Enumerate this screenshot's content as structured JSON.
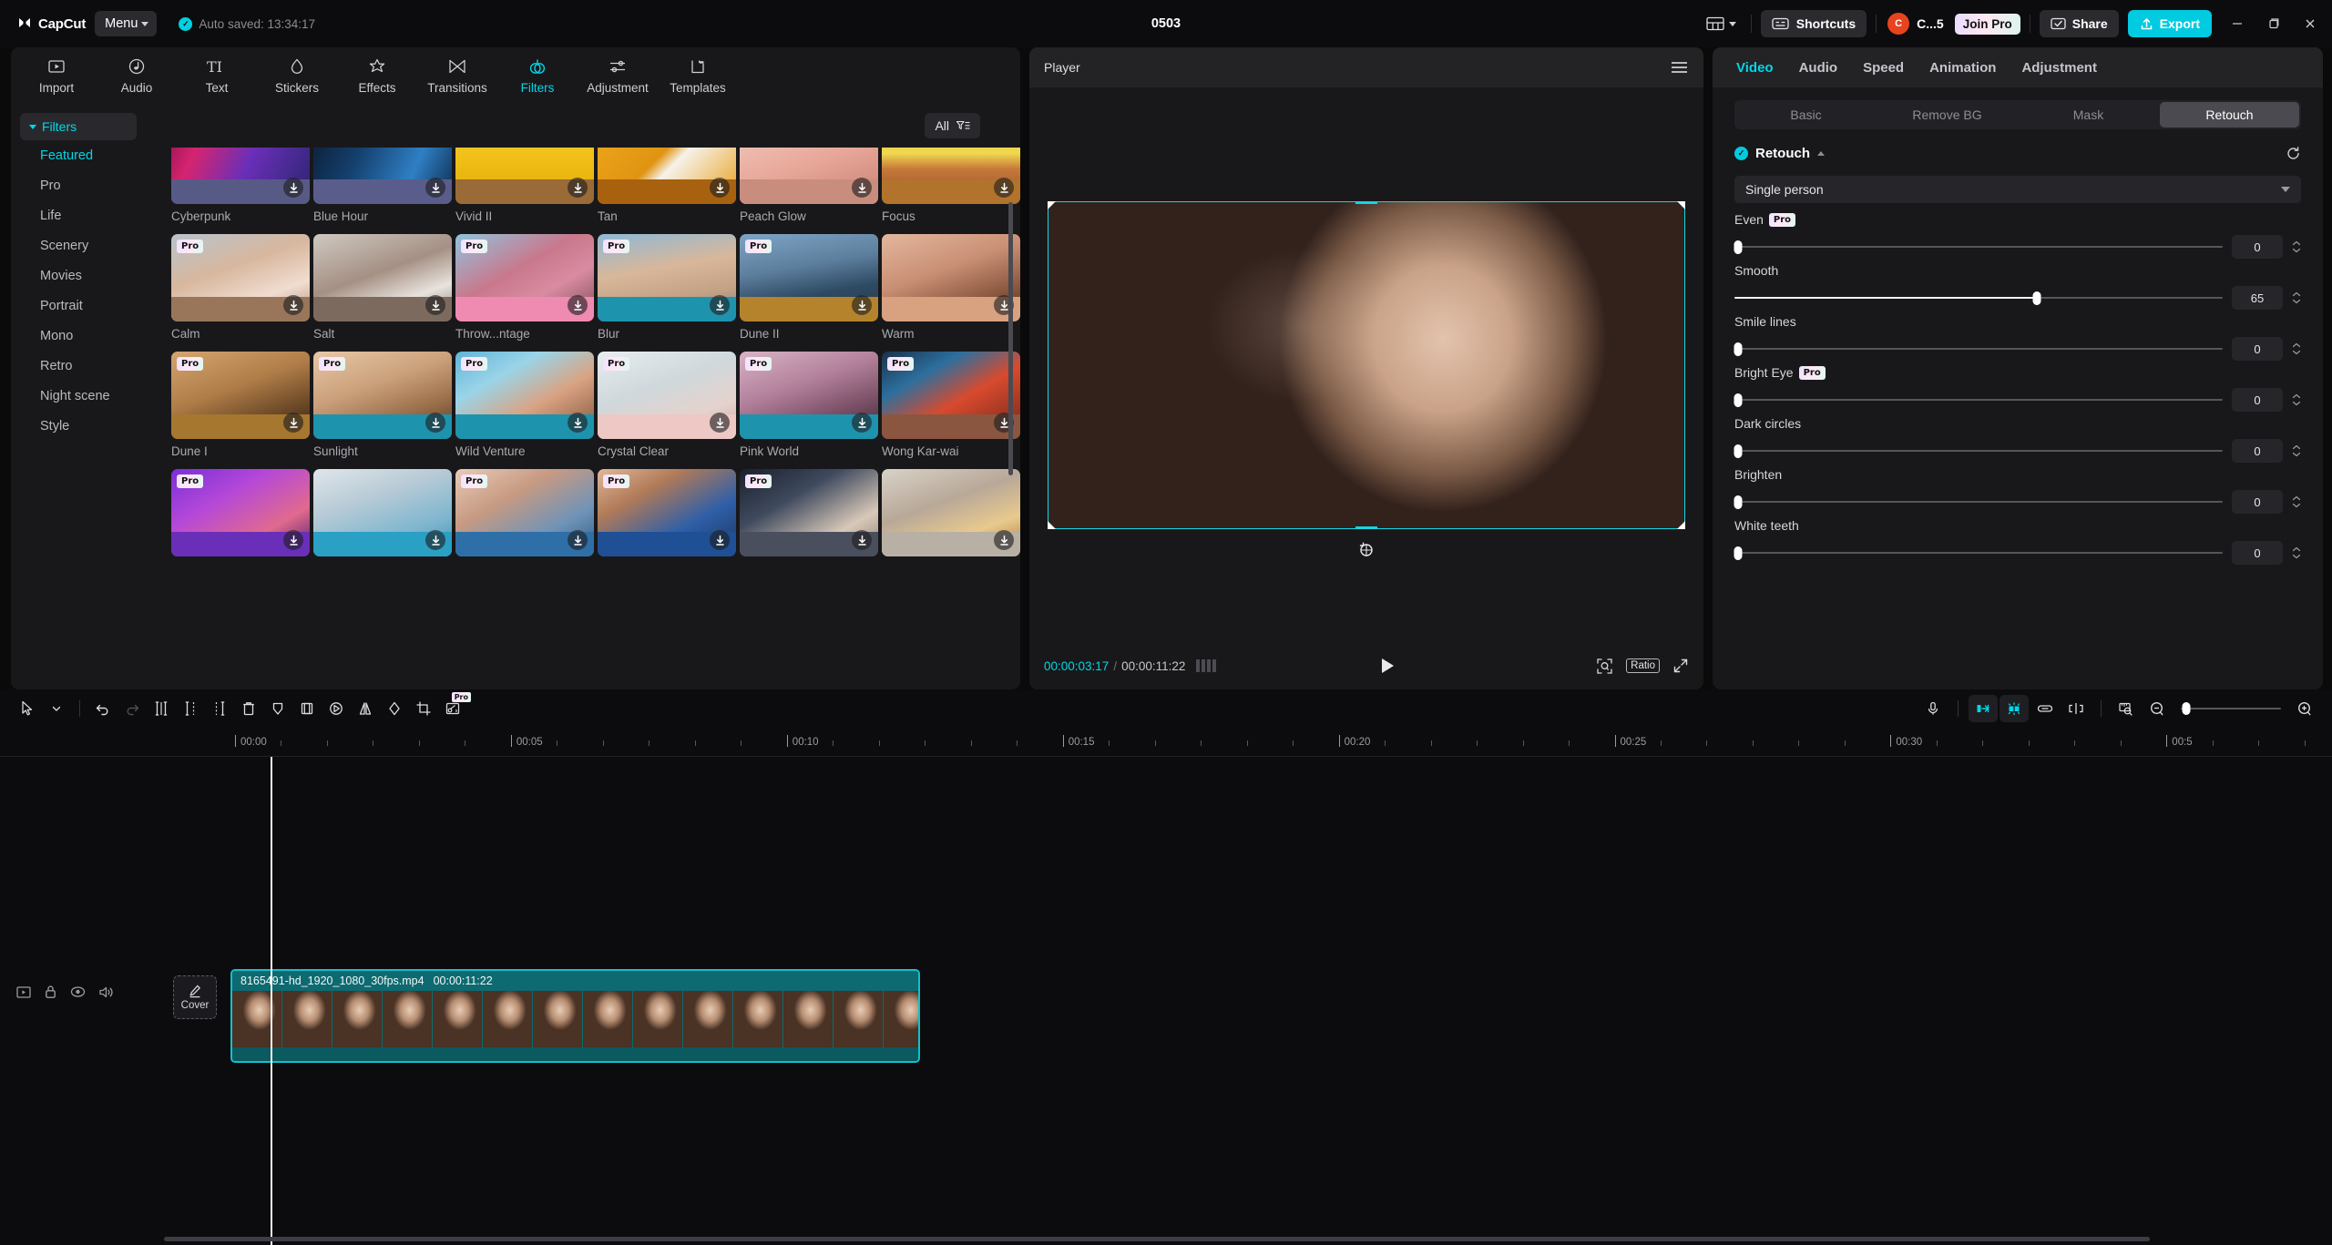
{
  "titlebar": {
    "brand": "CapCut",
    "menu_label": "Menu",
    "autosave_text": "Auto saved: 13:34:17",
    "project_title": "0503",
    "shortcuts_label": "Shortcuts",
    "account_initial": "C",
    "account_name": "C...5",
    "join_pro_label": "Join Pro",
    "share_label": "Share",
    "export_label": "Export",
    "accent_color": "#00cbe0",
    "icons": {
      "layout": "layout-grid-icon",
      "layout_caret": "chevron-down-icon",
      "shortcuts": "keyboard-icon",
      "share": "share-icon",
      "export": "upload-icon",
      "minimize": "minimize-icon",
      "maximize": "maximize-icon",
      "close": "close-icon"
    }
  },
  "toolbar": {
    "tabs": [
      {
        "label": "Import",
        "icon": "media-import-icon",
        "active": false
      },
      {
        "label": "Audio",
        "icon": "audio-note-icon",
        "active": false
      },
      {
        "label": "Text",
        "icon": "text-ti-icon",
        "active": false
      },
      {
        "label": "Stickers",
        "icon": "sticker-drop-icon",
        "active": false
      },
      {
        "label": "Effects",
        "icon": "effects-star-icon",
        "active": false
      },
      {
        "label": "Transitions",
        "icon": "transitions-bowtie-icon",
        "active": false
      },
      {
        "label": "Filters",
        "icon": "filters-rings-icon",
        "active": true
      },
      {
        "label": "Adjustment",
        "icon": "adjustment-sliders-icon",
        "active": false
      },
      {
        "label": "Templates",
        "icon": "templates-flag-icon",
        "active": false
      }
    ]
  },
  "categories": {
    "header": "Filters",
    "items": [
      {
        "label": "Featured",
        "active": true
      },
      {
        "label": "Pro",
        "active": false
      },
      {
        "label": "Life",
        "active": false
      },
      {
        "label": "Scenery",
        "active": false
      },
      {
        "label": "Movies",
        "active": false
      },
      {
        "label": "Portrait",
        "active": false
      },
      {
        "label": "Mono",
        "active": false
      },
      {
        "label": "Retro",
        "active": false
      },
      {
        "label": "Night scene",
        "active": false
      },
      {
        "label": "Style",
        "active": false
      }
    ]
  },
  "filter_grid": {
    "filter_button_label": "All",
    "filter_button_icon": "filter-sort-icon",
    "items": [
      {
        "name": "Cyberpunk",
        "pro": false,
        "top": "linear-gradient(115deg,#8d1050 0%,#d6246f 22%,#6a2fb8 55%,#2b2570 100%)",
        "bottom": "#585a86"
      },
      {
        "name": "Blue Hour",
        "pro": false,
        "top": "linear-gradient(115deg,#0b1b30 0%,#14406e 35%,#2f7fc4 70%,#0d2a4a 100%)",
        "bottom": "#5a5d8b"
      },
      {
        "name": "Vivid II",
        "pro": false,
        "top": "linear-gradient(180deg,#3f9fe0 0%,#63b7ea 34%,#f4c41c 36%,#e9b510 72%,#8e5b2a 74%)",
        "bottom": "#9a6b37"
      },
      {
        "name": "Tan",
        "pro": false,
        "top": "linear-gradient(135deg,#f0a91d 0%,#e09412 45%,#f6f2ea 55%,#e89c14 100%)",
        "bottom": "#a8620f"
      },
      {
        "name": "Peach Glow",
        "pro": false,
        "top": "linear-gradient(160deg,#f3cdc2 0%,#e8a99b 50%,#c98172 100%)",
        "bottom": "#c98d7e"
      },
      {
        "name": "Focus",
        "pro": false,
        "top": "linear-gradient(180deg,#e8c72c 0%,#f0d84f 42%,#c7793a 60%,#8a4d24 100%)",
        "bottom": "#b2732c"
      },
      {
        "name": "Calm",
        "pro": true,
        "top": "linear-gradient(160deg,#b9c3cb 0%,#d8b79e 40%,#f0ddd0 70%,#b08d74 100%)",
        "bottom": "#99765a"
      },
      {
        "name": "Salt",
        "pro": false,
        "top": "linear-gradient(160deg,#cfc9c1 0%,#a59084 45%,#e8e3dd 72%,#8a7a6c 100%)",
        "bottom": "#7d6a5e"
      },
      {
        "name": "Throw...ntage",
        "pro": true,
        "top": "linear-gradient(150deg,#8fc4de 0%,#c9788c 42%,#d98ba1 66%,#7a4a58 100%)",
        "bottom": "#ef8ab0"
      },
      {
        "name": "Blur",
        "pro": true,
        "top": "linear-gradient(170deg,#8fb9d6 0%,#d8b79a 40%,#c4a184 70%,#5e7f99 100%)",
        "bottom": "#1e93ad"
      },
      {
        "name": "Dune II",
        "pro": true,
        "top": "linear-gradient(170deg,#7fa4c4 0%,#5d7f9e 38%,#2e4a63 66%,#24384b 100%)",
        "bottom": "#b5832b"
      },
      {
        "name": "Warm",
        "pro": false,
        "top": "linear-gradient(160deg,#e3b79e 0%,#c98f74 42%,#8d5a42 72%,#4a2c1e 100%)",
        "bottom": "#d8a17f"
      },
      {
        "name": "Dune I",
        "pro": true,
        "top": "linear-gradient(160deg,#d4a570 0%,#b07d48 42%,#6d4a28 72%,#2e2014 100%)",
        "bottom": "#a6772f"
      },
      {
        "name": "Sunlight",
        "pro": true,
        "top": "linear-gradient(160deg,#e8c8a8 0%,#caa07a 40%,#9a6e4a 70%,#503524 100%)",
        "bottom": "#1e93ad"
      },
      {
        "name": "Wild Venture",
        "pro": true,
        "top": "linear-gradient(150deg,#5fb4d8 0%,#9ad4e8 30%,#d9a383 60%,#7c5236 100%)",
        "bottom": "#1e93ad"
      },
      {
        "name": "Crystal Clear",
        "pro": true,
        "top": "linear-gradient(160deg,#e9eef0 0%,#cfd8dc 40%,#e5d2cc 72%,#c7a79e 100%)",
        "bottom": "#edc8c4"
      },
      {
        "name": "Pink World",
        "pro": true,
        "top": "linear-gradient(160deg,#d8b4c6 0%,#b27f9a 40%,#7a4f66 70%,#3d2434 100%)",
        "bottom": "#1e93ad"
      },
      {
        "name": "Wong Kar-wai",
        "pro": true,
        "top": "linear-gradient(150deg,#1c2f4a 0%,#2c6f9e 28%,#d84a2e 56%,#6e2618 100%)",
        "bottom": "#8a5640"
      },
      {
        "name": "",
        "pro": true,
        "top": "linear-gradient(150deg,#7a2fd8 0%,#b548d8 35%,#e06a8e 70%,#4a1a6a 100%)",
        "bottom": "#6a2fb8"
      },
      {
        "name": "",
        "pro": false,
        "top": "linear-gradient(160deg,#dfe6ea 0%,#b8cbd6 35%,#7fb6cf 70%,#3d8fb0 100%)",
        "bottom": "#2aa0c4"
      },
      {
        "name": "",
        "pro": true,
        "top": "linear-gradient(150deg,#e8cbb8 0%,#c79a82 35%,#6f93b8 70%,#2f5a84 100%)",
        "bottom": "#2f6fa8"
      },
      {
        "name": "",
        "pro": true,
        "top": "linear-gradient(150deg,#e0b898 0%,#b07a58 30%,#2f5fa8 65%,#1b3560 100%)",
        "bottom": "#1f4f94"
      },
      {
        "name": "",
        "pro": true,
        "top": "linear-gradient(150deg,#1a1f2c 0%,#3f4a5e 35%,#d8c8b8 72%,#8a7f72 100%)",
        "bottom": "#4a4f5e"
      },
      {
        "name": "",
        "pro": false,
        "top": "linear-gradient(160deg,#d8d2c8 0%,#b8a898 40%,#e8c98e 70%,#a8763a 100%)",
        "bottom": "#b8b0a4"
      }
    ]
  },
  "player": {
    "title": "Player",
    "menu_icon": "hamburger-icon",
    "current_time": "00:00:03:17",
    "total_time": "00:00:11:22",
    "time_separator": "/",
    "play_icon": "play-icon",
    "levels_icon": "audio-levels-icon",
    "zoom_icon": "zoom-fit-icon",
    "ratio_label": "Ratio",
    "fullscreen_icon": "fullscreen-icon",
    "rotate_icon": "rotate-icon"
  },
  "right_panel": {
    "tabs": [
      {
        "label": "Video",
        "active": true
      },
      {
        "label": "Audio",
        "active": false
      },
      {
        "label": "Speed",
        "active": false
      },
      {
        "label": "Animation",
        "active": false
      },
      {
        "label": "Adjustment",
        "active": false
      }
    ],
    "segments": [
      {
        "label": "Basic",
        "active": false
      },
      {
        "label": "Remove BG",
        "active": false
      },
      {
        "label": "Mask",
        "active": false
      },
      {
        "label": "Retouch",
        "active": true
      }
    ],
    "section_title": "Retouch",
    "section_enabled": true,
    "reset_icon": "reset-icon",
    "person_select": "Single person",
    "sliders": [
      {
        "label": "Even",
        "pro": true,
        "value": "0",
        "percent": 0
      },
      {
        "label": "Smooth",
        "pro": false,
        "value": "65",
        "percent": 62
      },
      {
        "label": "Smile lines",
        "pro": false,
        "value": "0",
        "percent": 0
      },
      {
        "label": "Bright Eye",
        "pro": true,
        "value": "0",
        "percent": 0
      },
      {
        "label": "Dark circles",
        "pro": false,
        "value": "0",
        "percent": 0
      },
      {
        "label": "Brighten",
        "pro": false,
        "value": "0",
        "percent": 0
      },
      {
        "label": "White teeth",
        "pro": false,
        "value": "0",
        "percent": 0
      }
    ]
  },
  "timeline": {
    "tools_left": [
      {
        "icon": "select-arrow-icon",
        "state": "normal"
      },
      {
        "icon": "chevron-down-icon",
        "state": "normal"
      },
      {
        "icon": "undo-icon",
        "state": "normal"
      },
      {
        "icon": "redo-icon",
        "state": "disabled"
      },
      {
        "icon": "split-icon",
        "state": "normal"
      },
      {
        "icon": "trim-left-icon",
        "state": "normal"
      },
      {
        "icon": "trim-right-icon",
        "state": "normal"
      },
      {
        "icon": "delete-icon",
        "state": "normal"
      },
      {
        "icon": "keyframe-icon",
        "state": "normal"
      },
      {
        "icon": "freeze-frame-icon",
        "state": "normal"
      },
      {
        "icon": "reverse-icon",
        "state": "normal"
      },
      {
        "icon": "mirror-icon",
        "state": "normal"
      },
      {
        "icon": "rotate-icon",
        "state": "normal"
      },
      {
        "icon": "crop-icon",
        "state": "normal"
      },
      {
        "icon": "auto-cut-icon",
        "state": "pro"
      }
    ],
    "tools_right": [
      {
        "icon": "microphone-icon",
        "state": "normal"
      },
      {
        "icon": "adsorb-icon",
        "state": "on"
      },
      {
        "icon": "magnet-snap-icon",
        "state": "on"
      },
      {
        "icon": "link-icon",
        "state": "normal"
      },
      {
        "icon": "split-track-icon",
        "state": "normal"
      },
      {
        "icon": "ruler-icon",
        "state": "normal"
      },
      {
        "icon": "zoom-out-icon",
        "state": "normal"
      },
      {
        "icon": "zoom-in-icon",
        "state": "normal"
      }
    ],
    "ruler_labels": [
      "00:00",
      "00:05",
      "00:10",
      "00:15",
      "00:20",
      "00:25",
      "00:30",
      "00:5"
    ],
    "track_controls": [
      {
        "icon": "track-thumbnail-icon"
      },
      {
        "icon": "lock-icon"
      },
      {
        "icon": "eye-icon"
      },
      {
        "icon": "speaker-icon"
      }
    ],
    "cover_label": "Cover",
    "cover_icon": "pencil-icon",
    "clip": {
      "filename": "8165491-hd_1920_1080_30fps.mp4",
      "duration": "00:00:11:22"
    },
    "playhead_position_label": "00:00:03:17"
  }
}
